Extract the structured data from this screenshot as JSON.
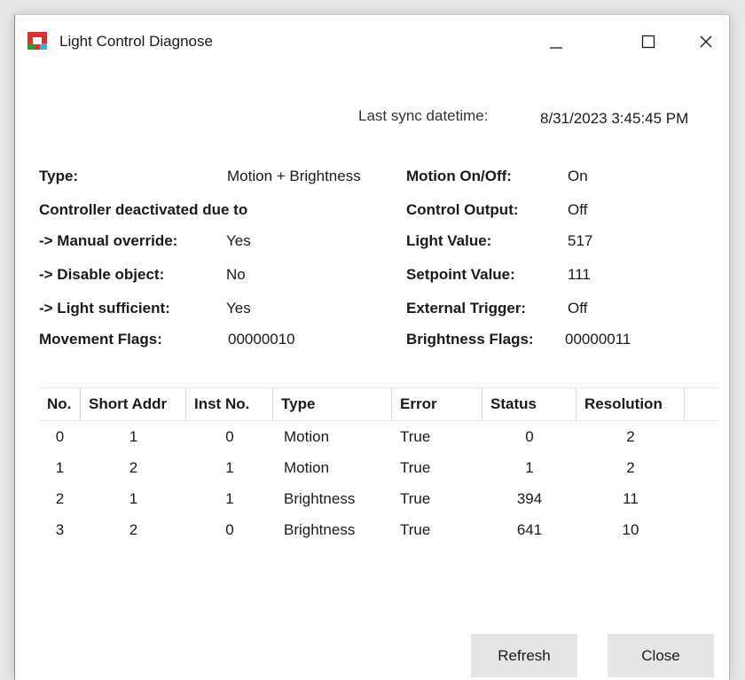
{
  "window": {
    "title": "Light Control Diagnose",
    "controls": {
      "minimize_icon": "minimize-icon",
      "maximize_icon": "maximize-icon",
      "close_icon": "close-icon"
    }
  },
  "sync": {
    "label": "Last sync datetime:",
    "value": "8/31/2023 3:45:45 PM"
  },
  "info_left": [
    {
      "label": "Type:",
      "value": "Motion + Brightness"
    },
    {
      "label": "Controller deactivated due to",
      "value": ""
    },
    {
      "label": "-> Manual override:",
      "value": "Yes"
    },
    {
      "label": "-> Disable object:",
      "value": "No"
    },
    {
      "label": "-> Light sufficient:",
      "value": "Yes"
    },
    {
      "label": "Movement Flags:",
      "value": "00000010"
    }
  ],
  "info_right": [
    {
      "label": "Motion On/Off:",
      "value": "On"
    },
    {
      "label": "Control Output:",
      "value": "Off"
    },
    {
      "label": "Light Value:",
      "value": "517"
    },
    {
      "label": "Setpoint Value:",
      "value": "111"
    },
    {
      "label": "External Trigger:",
      "value": "Off"
    },
    {
      "label": "Brightness Flags:",
      "value": "00000011"
    }
  ],
  "table": {
    "headers": [
      "No.",
      "Short Addr",
      "Inst No.",
      "Type",
      "Error",
      "Status",
      "Resolution"
    ],
    "rows": [
      [
        "0",
        "1",
        "0",
        "Motion",
        "True",
        "0",
        "2"
      ],
      [
        "1",
        "2",
        "1",
        "Motion",
        "True",
        "1",
        "2"
      ],
      [
        "2",
        "1",
        "1",
        "Brightness",
        "True",
        "394",
        "11"
      ],
      [
        "3",
        "2",
        "0",
        "Brightness",
        "True",
        "641",
        "10"
      ]
    ]
  },
  "buttons": {
    "refresh": "Refresh",
    "close": "Close"
  }
}
